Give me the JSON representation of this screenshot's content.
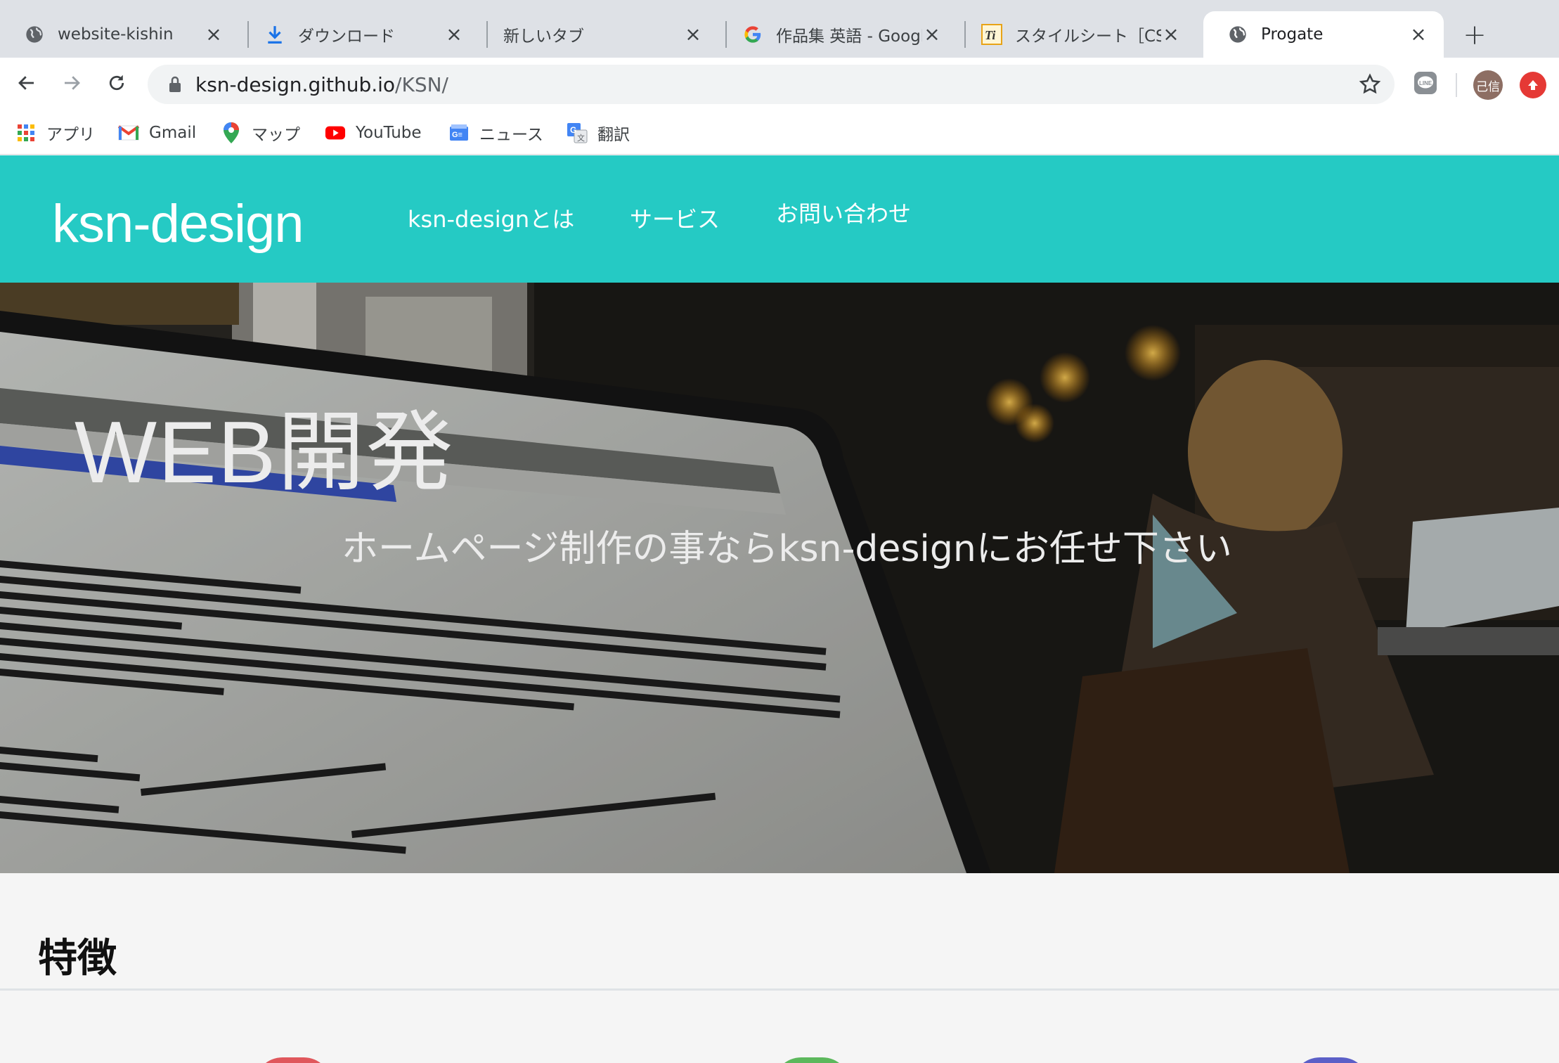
{
  "tabs": [
    {
      "title": "website-kishin",
      "icon": "globe-icon",
      "active": false
    },
    {
      "title": "ダウンロード",
      "icon": "download-icon",
      "active": false
    },
    {
      "title": "新しいタブ",
      "icon": "",
      "active": false
    },
    {
      "title": "作品集 英語 - Google",
      "icon": "google-icon",
      "active": false
    },
    {
      "title": "スタイルシート［CSS］",
      "icon": "ti-icon",
      "active": false
    },
    {
      "title": "Progate",
      "icon": "globe-icon",
      "active": true
    }
  ],
  "toolbar": {
    "url_host": "ksn-design.github.io",
    "url_path": "/KSN/",
    "avatar_text": "己信"
  },
  "bookmarks": [
    {
      "label": "アプリ",
      "icon": "apps-grid-icon"
    },
    {
      "label": "Gmail",
      "icon": "gmail-icon"
    },
    {
      "label": "マップ",
      "icon": "maps-pin-icon"
    },
    {
      "label": "YouTube",
      "icon": "youtube-icon"
    },
    {
      "label": "ニュース",
      "icon": "news-icon"
    },
    {
      "label": "翻訳",
      "icon": "translate-icon"
    }
  ],
  "site": {
    "logo": "ksn-design",
    "nav": [
      "ksn-designとは",
      "サービス",
      "お問い合わせ"
    ],
    "hero_title": "WEB開発",
    "hero_subtitle": "ホームページ制作の事ならksn-designにお任せ下さい",
    "features_heading": "特徴"
  },
  "colors": {
    "header_bg": "#25cac4",
    "tabstrip_bg": "#dee1e6",
    "page_bg": "#f5f5f5"
  }
}
